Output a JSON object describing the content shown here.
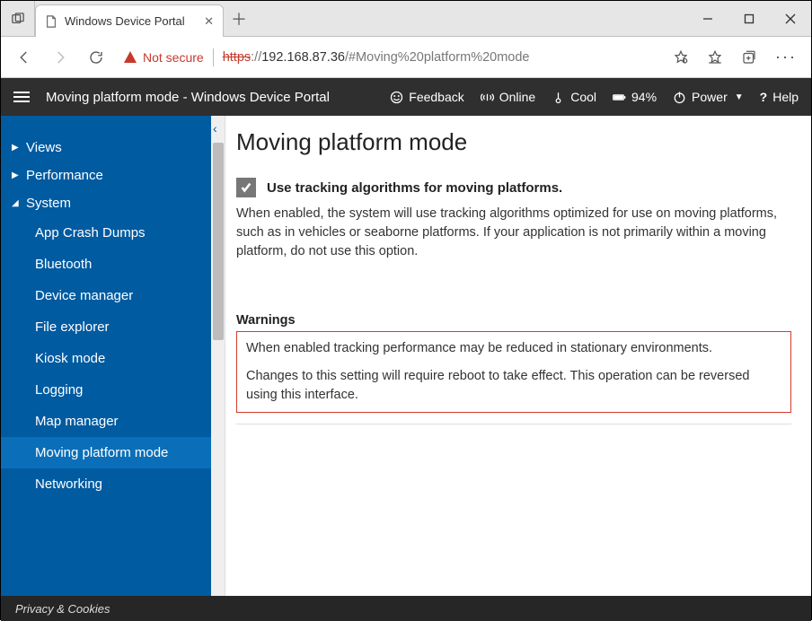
{
  "browser": {
    "tab_title": "Windows Device Portal",
    "security_label": "Not secure",
    "url_scheme_struck": "https",
    "url_sep": "://",
    "url_host": "192.168.87.36",
    "url_path": "/#Moving%20platform%20mode"
  },
  "appbar": {
    "title": "Moving platform mode - Windows Device Portal",
    "feedback": "Feedback",
    "online": "Online",
    "temp": "Cool",
    "battery": "94%",
    "power": "Power",
    "help": "Help"
  },
  "sidebar": {
    "groups": [
      {
        "label": "Views",
        "expanded": false
      },
      {
        "label": "Performance",
        "expanded": false
      }
    ],
    "system_label": "System",
    "system_items": [
      "App Crash Dumps",
      "Bluetooth",
      "Device manager",
      "File explorer",
      "Kiosk mode",
      "Logging",
      "Map manager",
      "Moving platform mode",
      "Networking"
    ],
    "active_index": 7
  },
  "content": {
    "heading": "Moving platform mode",
    "checkbox_label": "Use tracking algorithms for moving platforms.",
    "checkbox_checked": true,
    "description": "When enabled, the system will use tracking algorithms optimized for use on moving platforms, such as in vehicles or seaborne platforms. If your application is not primarily within a moving platform, do not use this option.",
    "warnings_title": "Warnings",
    "warning_line1": "When enabled tracking performance may be reduced in stationary environments.",
    "warning_line2": "Changes to this setting will require reboot to take effect. This operation can be reversed using this interface."
  },
  "footer": {
    "privacy": "Privacy & Cookies"
  }
}
